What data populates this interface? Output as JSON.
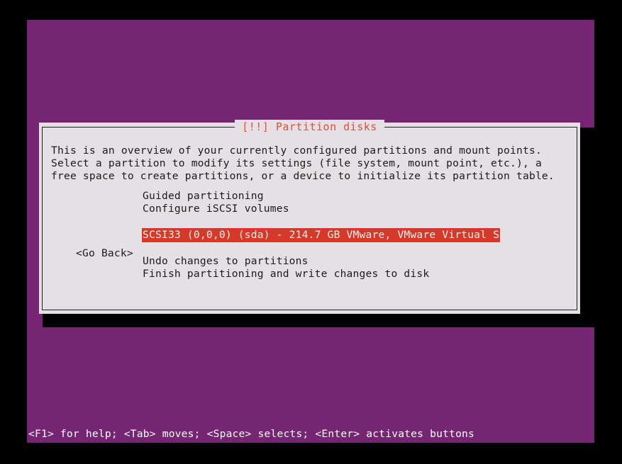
{
  "colors": {
    "screen_background": "#762572",
    "dialog_background": "#e4e0e4",
    "dialog_border": "#241f24",
    "title_text": "#e0503c",
    "highlight_background": "#d5392a",
    "highlight_text": "#f4efef",
    "status_text": "#ffffff",
    "body_text": "#1b1b1b",
    "shadow": "#000000"
  },
  "dialog": {
    "title": "[!!] Partition disks",
    "body": "This is an overview of your currently configured partitions and mount points. Select a partition to modify its settings (file system, mount point, etc.), a free space to create partitions, or a device to initialize its partition table.",
    "menu": {
      "group_one": [
        {
          "label": "Guided partitioning",
          "selected": false
        },
        {
          "label": "Configure iSCSI volumes",
          "selected": false
        }
      ],
      "group_two": [
        {
          "label": "SCSI33 (0,0,0) (sda) - 214.7 GB VMware, VMware Virtual S",
          "selected": true
        }
      ],
      "group_three": [
        {
          "label": "Undo changes to partitions",
          "selected": false
        },
        {
          "label": "Finish partitioning and write changes to disk",
          "selected": false
        }
      ]
    },
    "buttons": {
      "go_back": "<Go Back>"
    }
  },
  "status_bar": {
    "hint": "<F1> for help; <Tab> moves; <Space> selects; <Enter> activates buttons"
  }
}
